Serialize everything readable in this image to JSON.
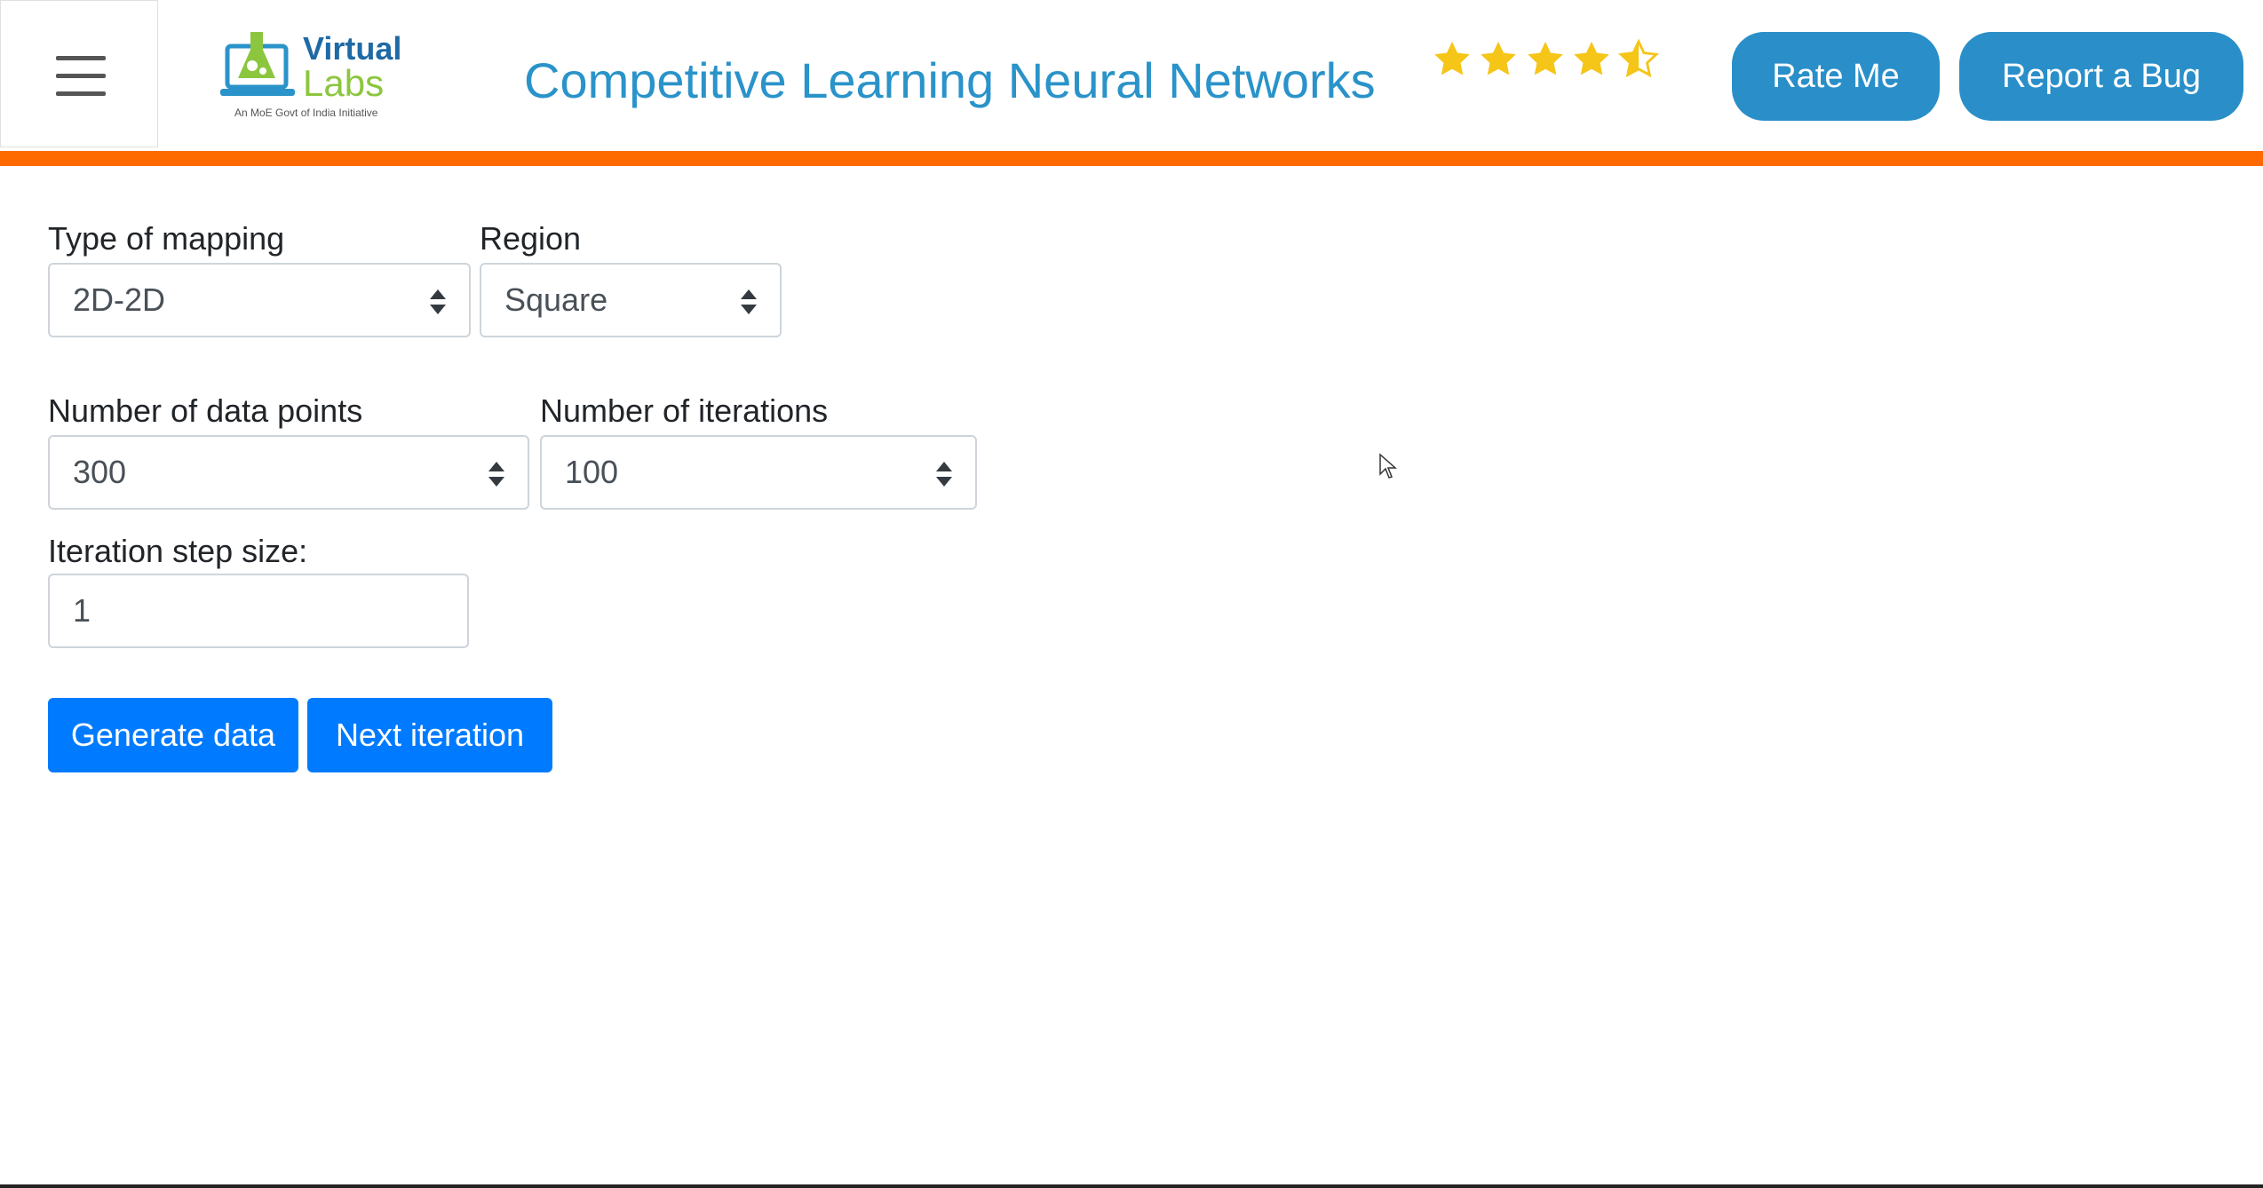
{
  "header": {
    "title": "Competitive Learning Neural Networks",
    "logo_top": "Virtual",
    "logo_bottom": "Labs",
    "logo_tagline": "An MoE Govt of India Initiative",
    "rating": 4.5,
    "rate_label": "Rate Me",
    "bug_label": "Report a Bug"
  },
  "form": {
    "mapping_label": "Type of mapping",
    "mapping_value": "2D-2D",
    "region_label": "Region",
    "region_value": "Square",
    "points_label": "Number of data points",
    "points_value": "300",
    "iterations_label": "Number of iterations",
    "iterations_value": "100",
    "step_label": "Iteration step size:",
    "step_value": "1"
  },
  "actions": {
    "generate_label": "Generate data",
    "next_label": "Next iteration"
  },
  "colors": {
    "accent": "#2a8fc9",
    "orange_bar": "#ff6a00",
    "primary": "#007bff",
    "star": "#f5c518"
  }
}
